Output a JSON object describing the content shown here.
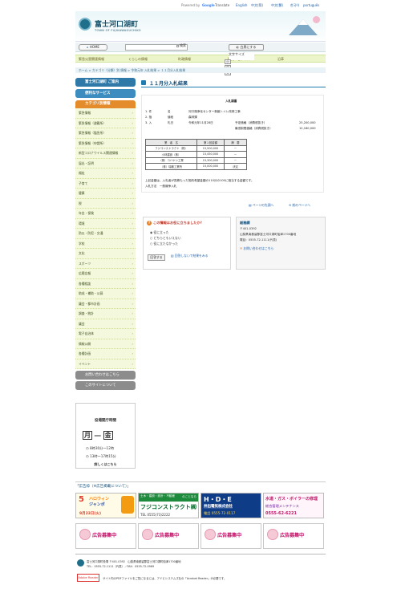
{
  "topbar": {
    "powered": "Powered by",
    "google": "Google",
    "translate": "Translate",
    "languages": [
      "English",
      "中文(简)",
      "中文(繁)",
      "한국어",
      "português"
    ]
  },
  "header": {
    "title": "富士河口湖町",
    "subtitle": "TOWN OF FUJIKAWAGUCHIKO"
  },
  "toolbar": {
    "home": "HOME",
    "search_alt": "検索",
    "contrast": "白黒にする",
    "font_size_label": "文字サイズ",
    "font_sizes": [
      "小",
      "中",
      "大"
    ]
  },
  "nav": {
    "items": [
      "緊急災害関連情報",
      "くらしの情報",
      "町政情報",
      "観光・ビジネス",
      "沿革"
    ]
  },
  "breadcrumb": "ホーム > カテゴリ（分類）別 情報 > 令和元年 入札結果 > １１月分入札結果",
  "sidebar": {
    "intro": "富士河口湖町 ご案内",
    "services": "便利なサービス",
    "category_head": "カテゴリ別情報",
    "items": [
      "緊急情報",
      "緊急情報（避難所）",
      "緊急情報（臨急所）",
      "緊急情報（申請所）",
      "新型コロナウイルス関連情報",
      "届出・証明",
      "福祉",
      "子育て",
      "健康",
      "税",
      "年金・保険",
      "環境",
      "防災・防犯・交通",
      "学校",
      "文化",
      "スポーツ",
      "広聴広報",
      "各種相談",
      "助成・補助・公募",
      "議会・都市計画",
      "調査・統計",
      "議会",
      "電子自治体",
      "情報公開",
      "各種計画",
      "イベント"
    ],
    "inquiry": "お問い合わせはこちら",
    "about_site": "このサイトについて"
  },
  "hours": {
    "title": "役場開庁時間",
    "days_from": "月",
    "days_dash": "―",
    "days_to": "金",
    "am": "8時30分〜12時",
    "pm": "13時〜17時15分",
    "more": "詳しくはこちら"
  },
  "main": {
    "title": "１１月分入札結果"
  },
  "doc": {
    "heading": "入札調書",
    "rows": [
      {
        "no": "1. 件",
        "label": "名",
        "value": "河口湖浄化センター新館トイレ改修工事"
      },
      {
        "no": "2. 指",
        "label": "値段",
        "value": "森林課"
      },
      {
        "no": "3. 入",
        "label": "札日",
        "value": "令和元年11月28日"
      }
    ],
    "est_label": "予定価格（消費税抜き）",
    "est_value": "25,200,000",
    "min_label": "最低制限価格（消費税抜き）",
    "min_value": "12,160,000",
    "table_header": [
      "業　者　名",
      "第１回金額",
      "摘　要"
    ],
    "table_rows": [
      [
        "フジコンストラクト（株）",
        "15,500,000",
        "ー"
      ],
      [
        "小林建設（株）",
        "15,450,000",
        "ー"
      ],
      [
        "（株）コバヤシ工業",
        "15,300,000",
        "ー"
      ],
      [
        "（株）瑞穂工業所",
        "15,000,000",
        "決定"
      ]
    ],
    "note1": "上記金額は、入札者が見積もった契約希望金額の110分の100に相当する金額です。",
    "note2": "入札方法　一般競争入札"
  },
  "pagenav": {
    "top": "ページの先頭へ",
    "prev": "前のページへ"
  },
  "survey": {
    "question": "この情報はお役に立ちましたか？",
    "options": [
      "役に立った",
      "どちらともいえない",
      "役に立たなかった"
    ],
    "submit": "回答する",
    "skip": "回答しないで結果をみる"
  },
  "contact": {
    "dept": "総務課",
    "zip": "〒401-0392",
    "address": "山梨県南都留郡富士河口湖町船津1700番地",
    "tel": "電話：0555-72-1111(代表)",
    "link": "お問い合わせはこちら"
  },
  "ads": {
    "title": "「広告枠（※広告掲載について）」",
    "items": [
      {
        "line1": "ハロウィン",
        "line2": "ジャンボ",
        "line3": "9月23日(火)"
      },
      {
        "line1": "土木・建設・設計・不動産",
        "line2": "のことなら",
        "line3": "フジコンストラクト㈱",
        "line4": "TEL 0555(73)2222"
      },
      {
        "line1": "H・D・E",
        "line2": "井出電気株式会社",
        "line3": "電話 0555-72-0117"
      },
      {
        "line1": "水道・ガス・ボイラーの修理",
        "line2": "総合管理メンテナンス",
        "line3": "0555-62-6221"
      }
    ],
    "placeholder": "広告募集中"
  },
  "footer": {
    "org": "富士河口湖町役場",
    "address": "〒401-0392　山梨県南都留郡富士河口湖町船津1700番地",
    "tel": "TEL：0555-72-1111（代表）／FAX：0555-72-0969",
    "reader": "Adobe Reader",
    "pdf_note": "サイト内のPDFファイルをご覧になるには、アドビシステムズ社の「Acrobat Reader」が必要です。"
  },
  "colors": {
    "accent": "#1f7cae",
    "nav_bg": "#ecf5c9",
    "sidebar_orange": "#e48b2c",
    "sidebar_blue": "#2f79a8",
    "ad_pink": "#c2186b"
  }
}
